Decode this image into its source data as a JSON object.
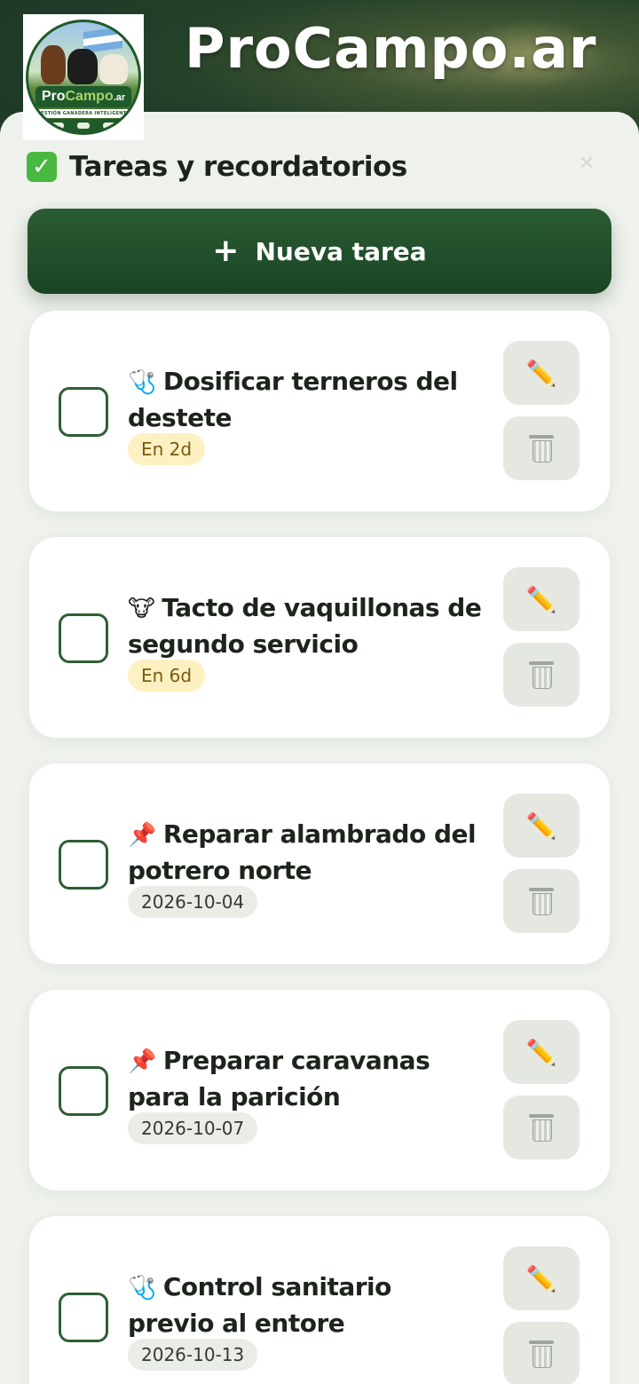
{
  "app": {
    "brand_title": "ProCampo.ar",
    "logo_name_main": "Pro",
    "logo_name_accent": "Campo",
    "logo_name_suffix": ".ar",
    "logo_tagline": "GESTIÓN GANADERA INTELIGENTE"
  },
  "panel": {
    "title": "Tareas y recordatorios",
    "title_icon": "check-mark-icon",
    "close_label": "✕",
    "new_task_label": "Nueva tarea",
    "new_task_icon": "+"
  },
  "tasks": [
    {
      "icon": "stethoscope-icon",
      "emoji": "🩺",
      "title": "Dosificar terneros del destete",
      "badge": "En 2d",
      "badge_type": "soon",
      "edit_icon": "✏️"
    },
    {
      "icon": "cow-icon",
      "emoji": "🐮",
      "title": "Tacto de vaquillonas de segundo servicio",
      "badge": "En 6d",
      "badge_type": "soon",
      "edit_icon": "✏️"
    },
    {
      "icon": "pushpin-icon",
      "emoji": "📌",
      "title": "Reparar alambrado del potrero norte",
      "badge": "2026-10-04",
      "badge_type": "date",
      "edit_icon": "✏️"
    },
    {
      "icon": "pushpin-icon",
      "emoji": "📌",
      "title": "Preparar caravanas para la parición",
      "badge": "2026-10-07",
      "badge_type": "date",
      "edit_icon": "✏️"
    },
    {
      "icon": "stethoscope-icon",
      "emoji": "🩺",
      "title": "Control sanitario previo al entore",
      "badge": "2026-10-13",
      "badge_type": "date",
      "edit_icon": "✏️"
    }
  ],
  "colors": {
    "primary_green": "#1f4a28",
    "badge_soon_bg": "#fdf1c2",
    "badge_date_bg": "#eaede6"
  }
}
